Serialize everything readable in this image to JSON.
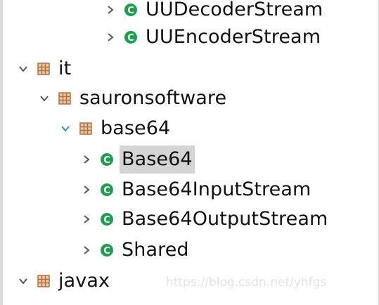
{
  "tree": {
    "rows": [
      {
        "label": "UUDecoderStream",
        "kind": "class",
        "expanded": false
      },
      {
        "label": "UUEncoderStream",
        "kind": "class",
        "expanded": false
      },
      {
        "label": "it",
        "kind": "package",
        "expanded": true
      },
      {
        "label": "sauronsoftware",
        "kind": "package",
        "expanded": true
      },
      {
        "label": "base64",
        "kind": "package",
        "expanded": true
      },
      {
        "label": "Base64",
        "kind": "class",
        "expanded": false,
        "selected": true
      },
      {
        "label": "Base64InputStream",
        "kind": "class",
        "expanded": false
      },
      {
        "label": "Base64OutputStream",
        "kind": "class",
        "expanded": false
      },
      {
        "label": "Shared",
        "kind": "class",
        "expanded": false
      },
      {
        "label": "javax",
        "kind": "package",
        "expanded": true
      }
    ]
  },
  "watermark": "https://blog.csdn.net/yhfgs",
  "colors": {
    "class_icon": "#1e9e4f",
    "package_icon": "#b5703a",
    "chevron": "#555555",
    "chevron_active": "#2b8fd6",
    "selection": "#d4d4d4"
  }
}
